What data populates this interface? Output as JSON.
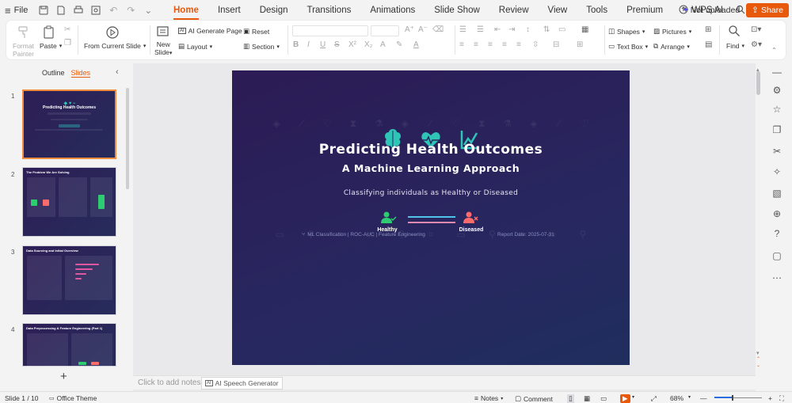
{
  "titlebar": {
    "file_label": "File",
    "tabs": [
      {
        "label": "Home",
        "active": true
      },
      {
        "label": "Insert"
      },
      {
        "label": "Design"
      },
      {
        "label": "Transitions"
      },
      {
        "label": "Animations"
      },
      {
        "label": "Slide Show"
      },
      {
        "label": "Review"
      },
      {
        "label": "View"
      },
      {
        "label": "Tools"
      },
      {
        "label": "Premium"
      },
      {
        "label": "WPS AI"
      }
    ],
    "not_uploaded": "Not uploaded",
    "share": "Share"
  },
  "ribbon": {
    "format_painter_1": "Format",
    "format_painter_2": "Painter",
    "paste": "Paste",
    "from_current_slide": "From Current Slide",
    "new_slide_1": "New",
    "new_slide_2": "Slide",
    "ai_generate_page": "AI Generate Page",
    "reset": "Reset",
    "layout": "Layout",
    "section": "Section",
    "shapes": "Shapes",
    "pictures": "Pictures",
    "text_box": "Text Box",
    "arrange": "Arrange",
    "find": "Find"
  },
  "leftpane": {
    "outline_tab": "Outline",
    "slides_tab": "Slides",
    "thumbnails": [
      {
        "num": "1",
        "title": "Predicting Health Outcomes"
      },
      {
        "num": "2",
        "title": "The Problem We Are Solving"
      },
      {
        "num": "3",
        "title": "Data Sourcing and Initial Overview"
      },
      {
        "num": "4",
        "title": "Data Preprocessing & Feature Engineering (Part 1)"
      }
    ]
  },
  "slide": {
    "title": "Predicting Health Outcomes",
    "subtitle": "A Machine Learning Approach",
    "tagline": "Classifying individuals as Healthy or Diseased",
    "healthy": "Healthy",
    "diseased": "Diseased",
    "footer_left": "ML Classification | ROC-AUC | Feature Engineering",
    "footer_right": "Report Date: 2025-07-31"
  },
  "notes": {
    "placeholder": "Click to add notes",
    "ai_speech": "AI Speech Generator"
  },
  "status": {
    "slide_count": "Slide 1 / 10",
    "theme": "Office Theme",
    "notes": "Notes",
    "comment": "Comment",
    "zoom": "68%"
  },
  "colors": {
    "accent": "#e8590c",
    "teal": "#2ec4b6",
    "healthy": "#2ecc71",
    "diseased": "#ff6b6b"
  }
}
